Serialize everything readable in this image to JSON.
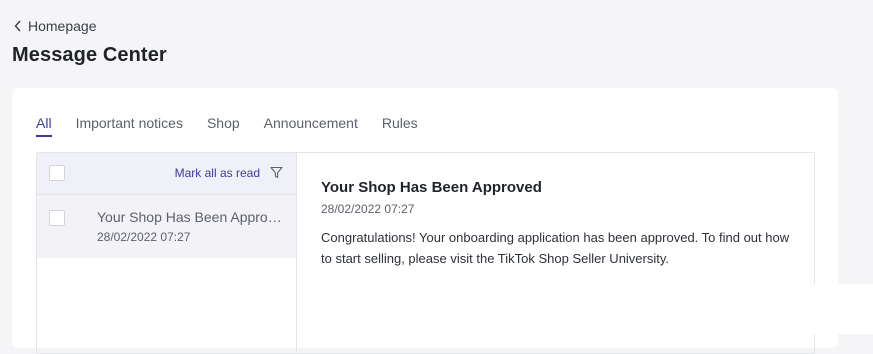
{
  "nav": {
    "back_label": "Homepage"
  },
  "page": {
    "title": "Message Center"
  },
  "tabs": [
    {
      "label": "All",
      "active": true
    },
    {
      "label": "Important notices",
      "active": false
    },
    {
      "label": "Shop",
      "active": false
    },
    {
      "label": "Announcement",
      "active": false
    },
    {
      "label": "Rules",
      "active": false
    }
  ],
  "list": {
    "mark_all_label": "Mark all as read",
    "filter_icon": "filter-icon",
    "items": [
      {
        "title": "Your Shop Has Been Approved",
        "date": "28/02/2022 07:27"
      }
    ]
  },
  "detail": {
    "title": "Your Shop Has Been Approved",
    "date": "28/02/2022 07:27",
    "body": "Congratulations! Your onboarding application has been approved. To find out how to start selling, please visit the TikTok Shop Seller University."
  },
  "colors": {
    "accent": "#3e3c9b",
    "background": "#f5f5f7",
    "selected_row": "#f2f2f7",
    "header_row": "#eff0f8"
  }
}
